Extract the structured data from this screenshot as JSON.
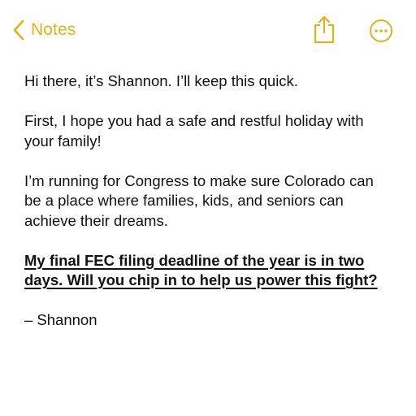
{
  "colors": {
    "accent": "#E2B01C",
    "text": "#111111",
    "background": "#FFFFFF"
  },
  "nav": {
    "back_icon": "chevron-left-icon",
    "back_label": "Notes",
    "share_icon": "share-icon",
    "more_icon": "more-ellipsis-icon"
  },
  "note": {
    "paragraphs": [
      "Hi there, it’s Shannon. I’ll keep this quick.",
      "First, I hope you had a safe and restful holiday with your family!",
      "I’m running for Congress to make sure Colorado can be a place where families, kids, and seniors can achieve their dreams.",
      "My final FEC filing deadline of the year is in two days. Will you chip in to help us power this fight?",
      "– Shannon"
    ]
  }
}
